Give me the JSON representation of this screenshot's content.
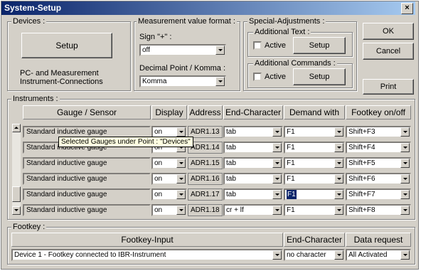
{
  "window": {
    "title": "System-Setup",
    "close_label": "×"
  },
  "devices": {
    "label": "Devices :",
    "setup_button": "Setup",
    "desc_line1": "PC- and Measurement",
    "desc_line2": "Instrument-Connections"
  },
  "format": {
    "label": "Measurement value format :",
    "sign_label": "Sign \"+\" :",
    "sign_value": "off",
    "decimal_label": "Decimal Point / Komma :",
    "decimal_value": "Komma"
  },
  "special": {
    "label": "Special-Adjustments :",
    "text_label": "Additional Text :",
    "text_active": "Active",
    "text_setup": "Setup",
    "cmd_label": "Additional Commands :",
    "cmd_active": "Active",
    "cmd_setup": "Setup"
  },
  "buttons": {
    "ok": "OK",
    "cancel": "Cancel",
    "print": "Print"
  },
  "instruments": {
    "label": "Instruments :",
    "headers": [
      "Gauge / Sensor",
      "Display",
      "Address",
      "End-Character",
      "Demand with",
      "Footkey on/off"
    ],
    "rows": [
      {
        "gauge": "Standard inductive gauge",
        "display": "on",
        "address": "ADR1.13",
        "end": "tab",
        "demand": "F1",
        "footkey": "Shift+F3"
      },
      {
        "gauge": "Standard inductive gauge",
        "display": "on",
        "address": "ADR1.14",
        "end": "tab",
        "demand": "F1",
        "footkey": "Shift+F4"
      },
      {
        "gauge": "Standard inductive gauge",
        "display": "on",
        "address": "ADR1.15",
        "end": "tab",
        "demand": "F1",
        "footkey": "Shift+F5"
      },
      {
        "gauge": "Standard inductive gauge",
        "display": "on",
        "address": "ADR1.16",
        "end": "tab",
        "demand": "F1",
        "footkey": "Shift+F6"
      },
      {
        "gauge": "Standard inductive gauge",
        "display": "on",
        "address": "ADR1.17",
        "end": "tab",
        "demand": "F1",
        "footkey": "Shift+F7"
      },
      {
        "gauge": "Standard inductive gauge",
        "display": "on",
        "address": "ADR1.18",
        "end": "cr + lf",
        "demand": "F1",
        "footkey": "Shift+F8"
      }
    ],
    "tooltip": "Selected Gauges under Point : \"Devices\""
  },
  "footkey": {
    "label": "Footkey :",
    "headers": [
      "Footkey-Input",
      "End-Character",
      "Data request"
    ],
    "input_value": "Device 1 - Footkey connected to IBR-Instrument",
    "end_value": "no character",
    "request_value": "All Activated"
  }
}
